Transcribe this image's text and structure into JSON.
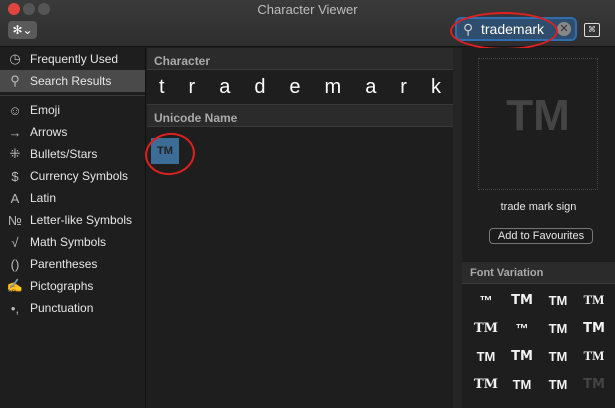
{
  "window": {
    "title": "Character Viewer"
  },
  "toolbar": {
    "gear": "✻⌄",
    "search_value": "trademark",
    "search_icon": "search-icon",
    "clear": "✕",
    "keyboard": "⌘"
  },
  "sidebar": {
    "items": [
      {
        "label": "Frequently Used",
        "icon": "◷"
      },
      {
        "label": "Search Results",
        "icon": "⚲"
      },
      {
        "label": "Emoji",
        "icon": "☺"
      },
      {
        "label": "Arrows",
        "icon": "→"
      },
      {
        "label": "Bullets/Stars",
        "icon": "⁜"
      },
      {
        "label": "Currency Symbols",
        "icon": "$"
      },
      {
        "label": "Latin",
        "icon": "A"
      },
      {
        "label": "Letter-like Symbols",
        "icon": "№"
      },
      {
        "label": "Math Symbols",
        "icon": "√"
      },
      {
        "label": "Parentheses",
        "icon": "()"
      },
      {
        "label": "Pictographs",
        "icon": "✍"
      },
      {
        "label": "Punctuation",
        "icon": "•,"
      }
    ]
  },
  "main": {
    "character_header": "Character",
    "characters": [
      "t",
      "r",
      "a",
      "d",
      "e",
      "m",
      "a",
      "r",
      "k"
    ],
    "unicode_header": "Unicode Name",
    "result": "TM"
  },
  "detail": {
    "preview": "TM",
    "name": "trade mark sign",
    "add_button": "Add to Favourites",
    "font_variation_header": "Font Variation",
    "variations": [
      "™",
      "TM",
      "TM",
      "TM",
      "TM",
      "™",
      "TM",
      "TM",
      "TM",
      "TM",
      "TM",
      "TM",
      "TM",
      "TM",
      "TM",
      "TM"
    ]
  }
}
